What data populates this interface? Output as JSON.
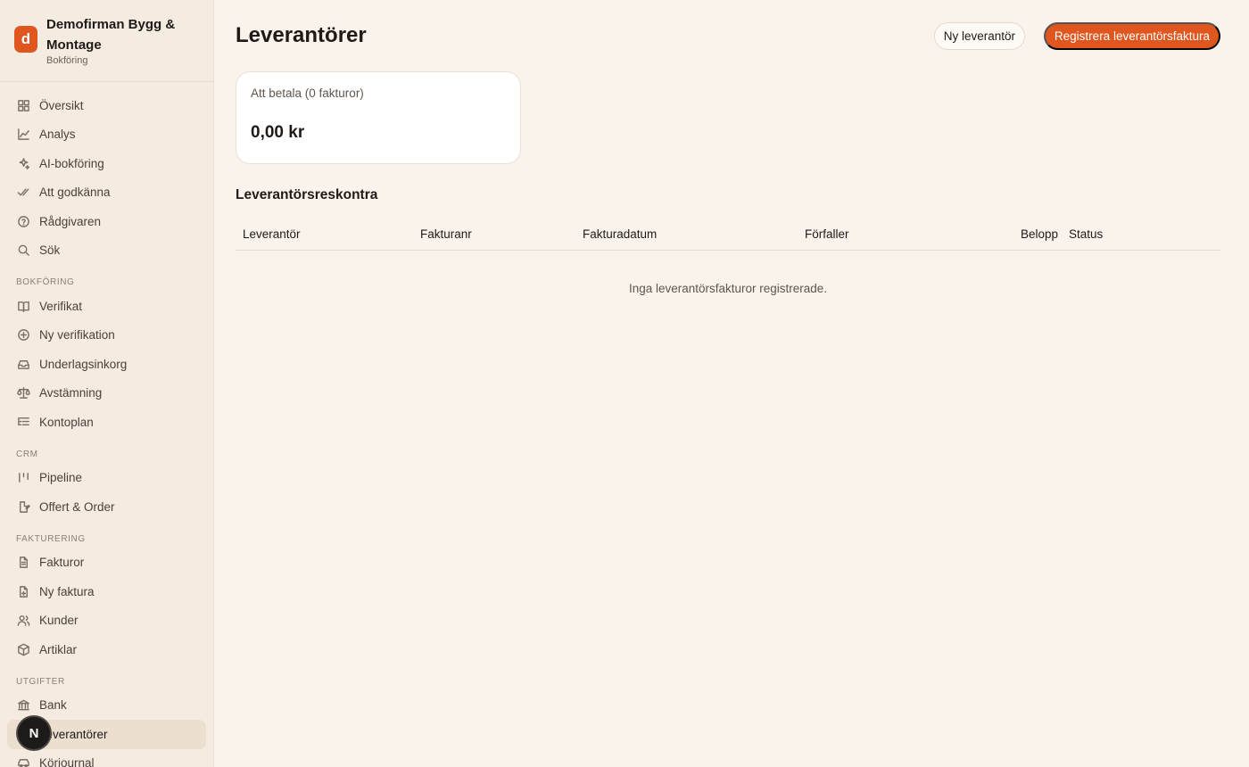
{
  "brand": {
    "logo_letter": "d",
    "name": "Demofirman Bygg & Montage",
    "subtitle": "Bokföring"
  },
  "nav": {
    "main": [
      {
        "label": "Översikt",
        "icon": "grid-icon"
      },
      {
        "label": "Analys",
        "icon": "chart-line-icon"
      },
      {
        "label": "AI-bokföring",
        "icon": "sparkles-icon"
      },
      {
        "label": "Att godkänna",
        "icon": "double-check-icon"
      },
      {
        "label": "Rådgivaren",
        "icon": "help-circle-icon"
      },
      {
        "label": "Sök",
        "icon": "search-icon"
      }
    ],
    "bokforing_label": "BOKFÖRING",
    "bokforing": [
      {
        "label": "Verifikat",
        "icon": "book-icon"
      },
      {
        "label": "Ny verifikation",
        "icon": "plus-circle-icon"
      },
      {
        "label": "Underlagsinkorg",
        "icon": "inbox-icon"
      },
      {
        "label": "Avstämning",
        "icon": "scale-icon"
      },
      {
        "label": "Kontoplan",
        "icon": "list-tree-icon"
      }
    ],
    "crm_label": "CRM",
    "crm": [
      {
        "label": "Pipeline",
        "icon": "pipeline-icon"
      },
      {
        "label": "Offert & Order",
        "icon": "file-edit-icon"
      }
    ],
    "fakturering_label": "FAKTURERING",
    "fakturering": [
      {
        "label": "Fakturor",
        "icon": "file-text-icon"
      },
      {
        "label": "Ny faktura",
        "icon": "file-plus-icon"
      },
      {
        "label": "Kunder",
        "icon": "users-icon"
      },
      {
        "label": "Artiklar",
        "icon": "package-icon"
      }
    ],
    "utgifter_label": "UTGIFTER",
    "utgifter": [
      {
        "label": "Bank",
        "icon": "bank-icon"
      },
      {
        "label": "Leverantörer",
        "icon": "truck-icon"
      },
      {
        "label": "Körjournal",
        "icon": "car-icon"
      }
    ]
  },
  "overlay_badge": "N",
  "page": {
    "title": "Leverantörer",
    "new_supplier_label": "Ny leverantör",
    "register_invoice_label": "Registrera leverantörsfaktura"
  },
  "stat": {
    "label": "Att betala (0 fakturor)",
    "value": "0,00 kr"
  },
  "ledger": {
    "title": "Leverantörsreskontra",
    "columns": [
      "Leverantör",
      "Fakturanr",
      "Fakturadatum",
      "Förfaller",
      "Belopp",
      "Status"
    ],
    "empty_text": "Inga leverantörsfakturor registrerade."
  },
  "colors": {
    "accent": "#e0561f",
    "background": "#faf3ec",
    "sidebar": "#f4ebe1"
  }
}
